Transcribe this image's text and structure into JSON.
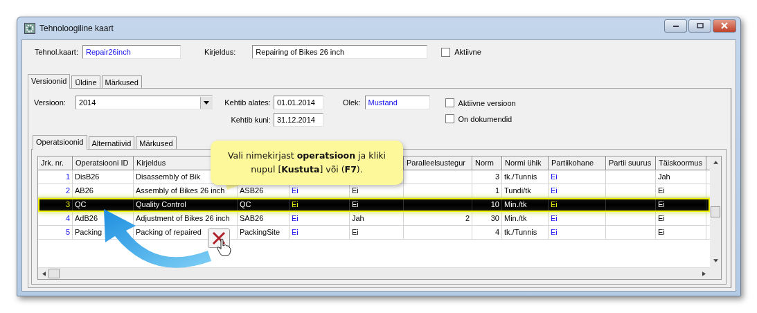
{
  "window": {
    "title": "Tehnoloogiline kaart"
  },
  "header": {
    "card": {
      "label": "Tehnol.kaart:",
      "value": "Repair26inch"
    },
    "description": {
      "label": "Kirjeldus:",
      "value": "Repairing of Bikes 26 inch"
    },
    "active": {
      "label": "Aktiivne",
      "checked": false
    }
  },
  "tabs": [
    {
      "label": "Versioonid",
      "selected": true
    },
    {
      "label": "Üldine",
      "selected": false
    },
    {
      "label": "Märkused",
      "selected": false
    }
  ],
  "version": {
    "version": {
      "label": "Versioon:",
      "value": "2014"
    },
    "valid_from": {
      "label": "Kehtib alates:",
      "value": "01.01.2014"
    },
    "valid_to": {
      "label": "Kehtib kuni:",
      "value": "31.12.2014"
    },
    "status": {
      "label": "Olek:",
      "value": "Mustand"
    },
    "checkboxes": [
      {
        "label": "Aktiivne versioon",
        "checked": false
      },
      {
        "label": "On dokumendid",
        "checked": false
      }
    ]
  },
  "subtabs": [
    {
      "label": "Operatsioonid",
      "selected": true
    },
    {
      "label": "Alternatiivid",
      "selected": false
    },
    {
      "label": "Märkused",
      "selected": false
    }
  ],
  "table": {
    "columns": [
      "Jrk. nr.",
      "Operatsiooni ID",
      "Kirjeldus",
      null,
      null,
      null,
      "Paralleelsustegur",
      "Norm",
      "Normi ühik",
      "Partiikohane",
      "Partii suurus",
      "Täiskoormus"
    ],
    "rows": [
      {
        "selected": false,
        "cells": [
          "1",
          "DisB26",
          "Disassembly of Bik",
          null,
          null,
          null,
          null,
          "3",
          "tk./Tunnis",
          "Ei",
          null,
          "Jah"
        ]
      },
      {
        "selected": false,
        "cells": [
          "2",
          "AB26",
          "Assembly of Bikes 26 inch",
          "ASB26",
          "Ei",
          "Ei",
          null,
          "1",
          "Tundi/tk",
          "Ei",
          null,
          "Ei"
        ]
      },
      {
        "selected": true,
        "cells": [
          "3",
          "QC",
          "Quality Control",
          "QC",
          "Ei",
          "Ei",
          null,
          "10",
          "Min./tk",
          "Ei",
          null,
          "Ei"
        ]
      },
      {
        "selected": false,
        "cells": [
          "4",
          "AdB26",
          "Adjustment of Bikes 26 inch",
          "SAB26",
          "Ei",
          "Jah",
          "2",
          "30",
          "Min./tk",
          "Ei",
          null,
          "Ei"
        ]
      },
      {
        "selected": false,
        "cells": [
          "5",
          "Packing",
          "Packing of repaired",
          "PackingSite",
          "Ei",
          "Ei",
          null,
          "4",
          "tk./Tunnis",
          "Ei",
          null,
          "Ei"
        ]
      }
    ]
  },
  "callout": {
    "text": "Vali nimekirjast **operatsioon** ja kliki nupul [**Kustuta**] või (**F7**)."
  }
}
